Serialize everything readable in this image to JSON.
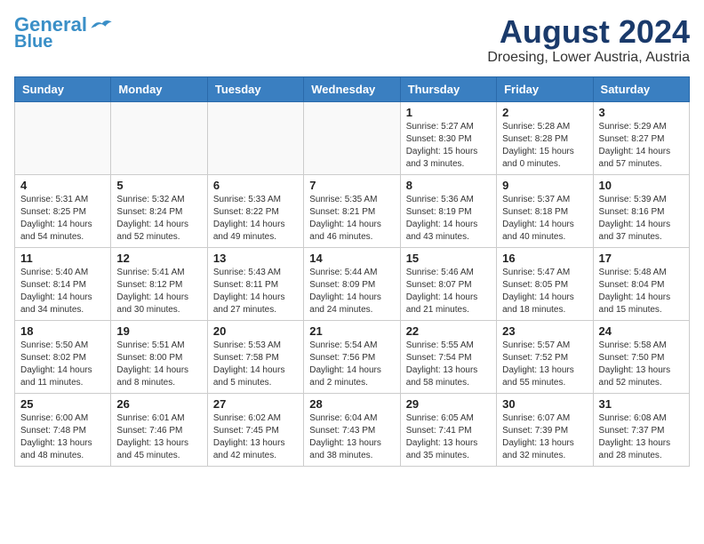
{
  "logo": {
    "line1": "General",
    "line2": "Blue"
  },
  "header": {
    "month": "August 2024",
    "location": "Droesing, Lower Austria, Austria"
  },
  "weekdays": [
    "Sunday",
    "Monday",
    "Tuesday",
    "Wednesday",
    "Thursday",
    "Friday",
    "Saturday"
  ],
  "weeks": [
    [
      {
        "day": "",
        "sunrise": "",
        "sunset": "",
        "daylight": ""
      },
      {
        "day": "",
        "sunrise": "",
        "sunset": "",
        "daylight": ""
      },
      {
        "day": "",
        "sunrise": "",
        "sunset": "",
        "daylight": ""
      },
      {
        "day": "",
        "sunrise": "",
        "sunset": "",
        "daylight": ""
      },
      {
        "day": "1",
        "sunrise": "Sunrise: 5:27 AM",
        "sunset": "Sunset: 8:30 PM",
        "daylight": "Daylight: 15 hours and 3 minutes."
      },
      {
        "day": "2",
        "sunrise": "Sunrise: 5:28 AM",
        "sunset": "Sunset: 8:28 PM",
        "daylight": "Daylight: 15 hours and 0 minutes."
      },
      {
        "day": "3",
        "sunrise": "Sunrise: 5:29 AM",
        "sunset": "Sunset: 8:27 PM",
        "daylight": "Daylight: 14 hours and 57 minutes."
      }
    ],
    [
      {
        "day": "4",
        "sunrise": "Sunrise: 5:31 AM",
        "sunset": "Sunset: 8:25 PM",
        "daylight": "Daylight: 14 hours and 54 minutes."
      },
      {
        "day": "5",
        "sunrise": "Sunrise: 5:32 AM",
        "sunset": "Sunset: 8:24 PM",
        "daylight": "Daylight: 14 hours and 52 minutes."
      },
      {
        "day": "6",
        "sunrise": "Sunrise: 5:33 AM",
        "sunset": "Sunset: 8:22 PM",
        "daylight": "Daylight: 14 hours and 49 minutes."
      },
      {
        "day": "7",
        "sunrise": "Sunrise: 5:35 AM",
        "sunset": "Sunset: 8:21 PM",
        "daylight": "Daylight: 14 hours and 46 minutes."
      },
      {
        "day": "8",
        "sunrise": "Sunrise: 5:36 AM",
        "sunset": "Sunset: 8:19 PM",
        "daylight": "Daylight: 14 hours and 43 minutes."
      },
      {
        "day": "9",
        "sunrise": "Sunrise: 5:37 AM",
        "sunset": "Sunset: 8:18 PM",
        "daylight": "Daylight: 14 hours and 40 minutes."
      },
      {
        "day": "10",
        "sunrise": "Sunrise: 5:39 AM",
        "sunset": "Sunset: 8:16 PM",
        "daylight": "Daylight: 14 hours and 37 minutes."
      }
    ],
    [
      {
        "day": "11",
        "sunrise": "Sunrise: 5:40 AM",
        "sunset": "Sunset: 8:14 PM",
        "daylight": "Daylight: 14 hours and 34 minutes."
      },
      {
        "day": "12",
        "sunrise": "Sunrise: 5:41 AM",
        "sunset": "Sunset: 8:12 PM",
        "daylight": "Daylight: 14 hours and 30 minutes."
      },
      {
        "day": "13",
        "sunrise": "Sunrise: 5:43 AM",
        "sunset": "Sunset: 8:11 PM",
        "daylight": "Daylight: 14 hours and 27 minutes."
      },
      {
        "day": "14",
        "sunrise": "Sunrise: 5:44 AM",
        "sunset": "Sunset: 8:09 PM",
        "daylight": "Daylight: 14 hours and 24 minutes."
      },
      {
        "day": "15",
        "sunrise": "Sunrise: 5:46 AM",
        "sunset": "Sunset: 8:07 PM",
        "daylight": "Daylight: 14 hours and 21 minutes."
      },
      {
        "day": "16",
        "sunrise": "Sunrise: 5:47 AM",
        "sunset": "Sunset: 8:05 PM",
        "daylight": "Daylight: 14 hours and 18 minutes."
      },
      {
        "day": "17",
        "sunrise": "Sunrise: 5:48 AM",
        "sunset": "Sunset: 8:04 PM",
        "daylight": "Daylight: 14 hours and 15 minutes."
      }
    ],
    [
      {
        "day": "18",
        "sunrise": "Sunrise: 5:50 AM",
        "sunset": "Sunset: 8:02 PM",
        "daylight": "Daylight: 14 hours and 11 minutes."
      },
      {
        "day": "19",
        "sunrise": "Sunrise: 5:51 AM",
        "sunset": "Sunset: 8:00 PM",
        "daylight": "Daylight: 14 hours and 8 minutes."
      },
      {
        "day": "20",
        "sunrise": "Sunrise: 5:53 AM",
        "sunset": "Sunset: 7:58 PM",
        "daylight": "Daylight: 14 hours and 5 minutes."
      },
      {
        "day": "21",
        "sunrise": "Sunrise: 5:54 AM",
        "sunset": "Sunset: 7:56 PM",
        "daylight": "Daylight: 14 hours and 2 minutes."
      },
      {
        "day": "22",
        "sunrise": "Sunrise: 5:55 AM",
        "sunset": "Sunset: 7:54 PM",
        "daylight": "Daylight: 13 hours and 58 minutes."
      },
      {
        "day": "23",
        "sunrise": "Sunrise: 5:57 AM",
        "sunset": "Sunset: 7:52 PM",
        "daylight": "Daylight: 13 hours and 55 minutes."
      },
      {
        "day": "24",
        "sunrise": "Sunrise: 5:58 AM",
        "sunset": "Sunset: 7:50 PM",
        "daylight": "Daylight: 13 hours and 52 minutes."
      }
    ],
    [
      {
        "day": "25",
        "sunrise": "Sunrise: 6:00 AM",
        "sunset": "Sunset: 7:48 PM",
        "daylight": "Daylight: 13 hours and 48 minutes."
      },
      {
        "day": "26",
        "sunrise": "Sunrise: 6:01 AM",
        "sunset": "Sunset: 7:46 PM",
        "daylight": "Daylight: 13 hours and 45 minutes."
      },
      {
        "day": "27",
        "sunrise": "Sunrise: 6:02 AM",
        "sunset": "Sunset: 7:45 PM",
        "daylight": "Daylight: 13 hours and 42 minutes."
      },
      {
        "day": "28",
        "sunrise": "Sunrise: 6:04 AM",
        "sunset": "Sunset: 7:43 PM",
        "daylight": "Daylight: 13 hours and 38 minutes."
      },
      {
        "day": "29",
        "sunrise": "Sunrise: 6:05 AM",
        "sunset": "Sunset: 7:41 PM",
        "daylight": "Daylight: 13 hours and 35 minutes."
      },
      {
        "day": "30",
        "sunrise": "Sunrise: 6:07 AM",
        "sunset": "Sunset: 7:39 PM",
        "daylight": "Daylight: 13 hours and 32 minutes."
      },
      {
        "day": "31",
        "sunrise": "Sunrise: 6:08 AM",
        "sunset": "Sunset: 7:37 PM",
        "daylight": "Daylight: 13 hours and 28 minutes."
      }
    ]
  ]
}
